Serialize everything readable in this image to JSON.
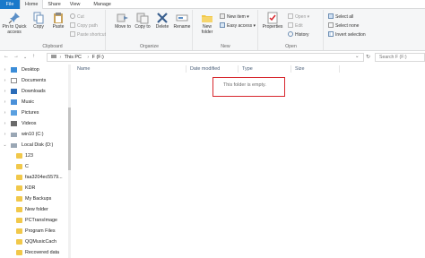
{
  "ribbon_tabs": [
    "File",
    "Home",
    "Share",
    "View",
    "Manage"
  ],
  "clipboard": {
    "pin_label": "Pin to Quick access",
    "copy_label": "Copy",
    "paste_label": "Paste",
    "cut_label": "Cut",
    "copy_path_label": "Copy path",
    "paste_shortcut_label": "Paste shortcut",
    "group_label": "Clipboard"
  },
  "organize": {
    "move_to_label": "Move to",
    "copy_to_label": "Copy to",
    "delete_label": "Delete",
    "rename_label": "Rename",
    "group_label": "Organize"
  },
  "new_group": {
    "new_folder_label": "New folder",
    "new_item_label": "New item",
    "easy_access_label": "Easy access",
    "group_label": "New"
  },
  "open_group": {
    "properties_label": "Properties",
    "open_label": "Open",
    "edit_label": "Edit",
    "history_label": "History",
    "group_label": "Open"
  },
  "select_group": {
    "select_all_label": "Select all",
    "select_none_label": "Select none",
    "invert_label": "Invert selection"
  },
  "address": {
    "crumbs": [
      "This PC",
      "F (F:)"
    ],
    "search_placeholder": "Search F (F:)"
  },
  "nav_items": [
    {
      "label": "Desktop"
    },
    {
      "label": "Documents"
    },
    {
      "label": "Downloads"
    },
    {
      "label": "Music"
    },
    {
      "label": "Pictures"
    },
    {
      "label": "Videos"
    },
    {
      "label": "win10 (C:)"
    },
    {
      "label": "Local Disk (D:)"
    },
    {
      "label": "123"
    },
    {
      "label": "C"
    },
    {
      "label": "faa3204ec5579..."
    },
    {
      "label": "KDR"
    },
    {
      "label": "My Backups"
    },
    {
      "label": "New folder"
    },
    {
      "label": "PCTransImage"
    },
    {
      "label": "Program Files"
    },
    {
      "label": "QQMusicCach"
    },
    {
      "label": "Recovered data"
    }
  ],
  "columns": {
    "name": "Name",
    "date": "Date modified",
    "type": "Type",
    "size": "Size"
  },
  "empty_message": "This folder is empty.",
  "colors": {
    "accent": "#1979ca",
    "highlight_box": "#d7262d",
    "folder": "#f1c84a"
  }
}
